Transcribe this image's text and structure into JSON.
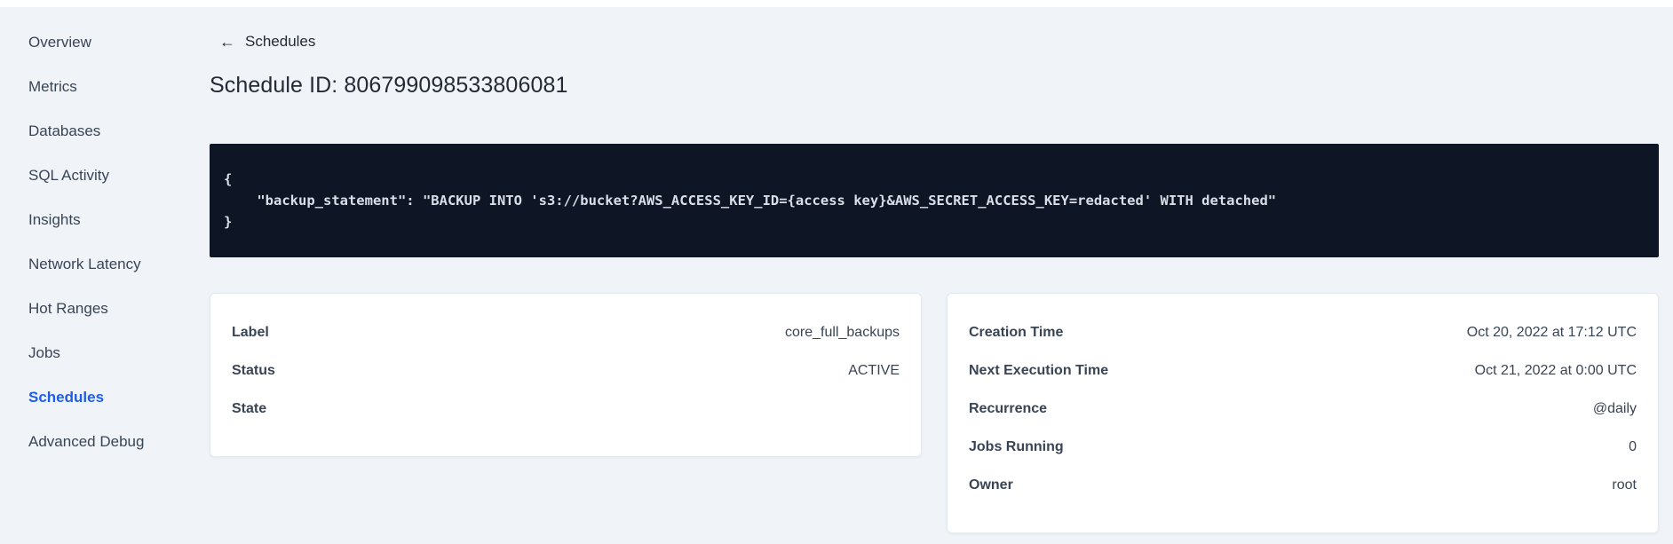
{
  "colors": {
    "accent": "#1f5de8",
    "page-bg": "#f0f4f8",
    "code-bg": "#0e1524",
    "code-text": "#d9dee8",
    "text-dark": "#242a35",
    "text-body": "#394455",
    "card-border": "#e4eaf1"
  },
  "sidebar": {
    "items": [
      {
        "label": "Overview",
        "active": false
      },
      {
        "label": "Metrics",
        "active": false
      },
      {
        "label": "Databases",
        "active": false
      },
      {
        "label": "SQL Activity",
        "active": false
      },
      {
        "label": "Insights",
        "active": false
      },
      {
        "label": "Network Latency",
        "active": false
      },
      {
        "label": "Hot Ranges",
        "active": false
      },
      {
        "label": "Jobs",
        "active": false
      },
      {
        "label": "Schedules",
        "active": true
      },
      {
        "label": "Advanced Debug",
        "active": false
      }
    ]
  },
  "header": {
    "back_icon": "←",
    "back_label": "Schedules",
    "title": "Schedule ID: 806799098533806081"
  },
  "code_block": {
    "lines": [
      "{",
      "    \"backup_statement\": \"BACKUP INTO 's3://bucket?AWS_ACCESS_KEY_ID={access key}&AWS_SECRET_ACCESS_KEY=redacted' WITH detached\"",
      "}"
    ]
  },
  "details_left": {
    "rows": [
      {
        "label": "Label",
        "value": "core_full_backups"
      },
      {
        "label": "Status",
        "value": "ACTIVE"
      },
      {
        "label": "State",
        "value": ""
      }
    ]
  },
  "details_right": {
    "rows": [
      {
        "label": "Creation Time",
        "value": "Oct 20, 2022 at 17:12 UTC"
      },
      {
        "label": "Next Execution Time",
        "value": "Oct 21, 2022 at 0:00 UTC"
      },
      {
        "label": "Recurrence",
        "value": "@daily"
      },
      {
        "label": "Jobs Running",
        "value": "0"
      },
      {
        "label": "Owner",
        "value": "root"
      }
    ]
  }
}
